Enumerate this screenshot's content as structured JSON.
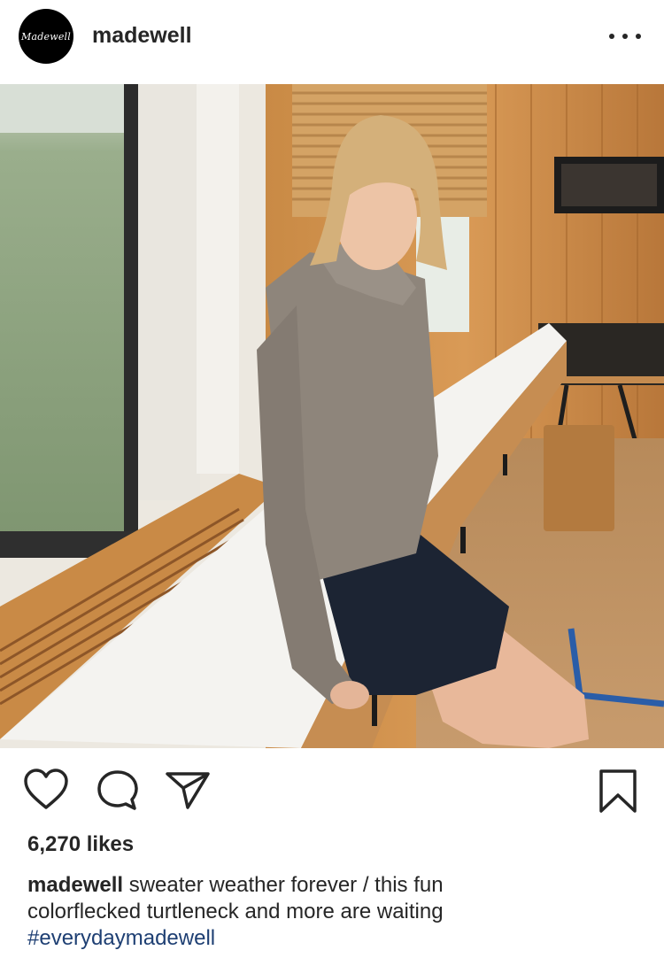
{
  "post": {
    "author": "madewell",
    "avatar_text": "Madewell",
    "likes": "6,270 likes",
    "caption_line1": "sweater weather forever / this fun",
    "caption_line2": "colorflecked turtleneck and more are waiting",
    "hashtag": "#everydaymadewell"
  },
  "icons": {
    "like": "heart-icon",
    "comment": "speech-bubble-icon",
    "share": "paper-plane-icon",
    "save": "bookmark-icon",
    "more": "more-dots-icon"
  },
  "colors": {
    "text": "#262626",
    "hashtag": "#1e3f73",
    "background": "#ffffff"
  }
}
